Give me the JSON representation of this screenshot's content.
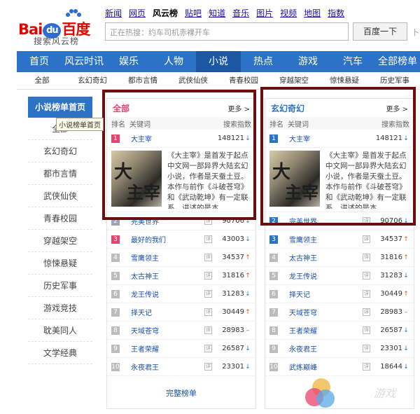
{
  "brand": {
    "left": "Bai",
    "du": "du",
    "right": "百度",
    "sub": "搜索风云榜"
  },
  "topnav": [
    "新闻",
    "网页",
    "风云榜",
    "贴吧",
    "知道",
    "音乐",
    "图片",
    "视频",
    "地图",
    "指数"
  ],
  "search": {
    "placeholder": "正在热搜：约车司机赤裸开车",
    "button": "百度一下"
  },
  "edge_char": "卜",
  "mainnav": [
    "首页",
    "风云时讯",
    "娱乐",
    "人物",
    "小说",
    "热点",
    "游戏",
    "汽车",
    "全部榜单"
  ],
  "subnav": [
    "全部",
    "玄幻奇幻",
    "都市言情",
    "武侠仙侠",
    "青春校园",
    "穿越架空",
    "惊悚悬疑",
    "历史军事"
  ],
  "sidebar": {
    "head": "小说榜单首页",
    "tooltip": "小说榜单首页",
    "items": [
      "全部",
      "玄幻奇幻",
      "都市言情",
      "武侠仙侠",
      "青春校园",
      "穿越架空",
      "惊悚悬疑",
      "历史军事",
      "游戏竞技",
      "耽美同人",
      "文学经典"
    ]
  },
  "panel_left": {
    "title": "全部",
    "more": "更多 >",
    "col_rank": "排名",
    "col_kw": "关键词",
    "col_idx": "搜索指数",
    "top": {
      "rank": "1",
      "kw": "大主宰",
      "num": "148121",
      "dir": "↓"
    },
    "cover": [
      "大",
      "主宰"
    ],
    "desc": "《大主宰》是首发于起点中文网一部异界大陆玄幻小说，作者是天蚕土豆。本作与前作《斗破苍穹》和《武动乾坤》有一定联系，讲述的是本...",
    "rows": [
      {
        "rank": "2",
        "kw": "完美世界",
        "num": "90706",
        "dir": "↓"
      },
      {
        "rank": "3",
        "kw": "最好的我们",
        "num": "43003",
        "dir": "↓"
      },
      {
        "rank": "4",
        "kw": "雪鹰领主",
        "num": "34537",
        "dir": "↑"
      },
      {
        "rank": "5",
        "kw": "太古神王",
        "num": "31816",
        "dir": "↑"
      },
      {
        "rank": "6",
        "kw": "龙王传说",
        "num": "31283",
        "dir": "↓"
      },
      {
        "rank": "7",
        "kw": "择天记",
        "num": "30449",
        "dir": "↑"
      },
      {
        "rank": "8",
        "kw": "天域苍穹",
        "num": "28983",
        "dir": "–"
      },
      {
        "rank": "9",
        "kw": "王者荣耀",
        "num": "26587",
        "dir": "↓"
      },
      {
        "rank": "10",
        "kw": "永夜君王",
        "num": "23301",
        "dir": "↓"
      }
    ],
    "bottom": "完整榜单"
  },
  "panel_right": {
    "title": "玄幻奇幻",
    "more": "更多 >",
    "col_rank": "排名",
    "col_kw": "关键词",
    "col_idx": "搜索指数",
    "top": {
      "rank": "1",
      "kw": "大主宰",
      "num": "148121",
      "dir": "↓"
    },
    "cover": [
      "大",
      "主宰"
    ],
    "desc": "《大主宰》是首发于起点中文网一部异界大陆玄幻小说，作者是天蚕土豆。本作与前作《斗破苍穹》和《武动乾坤》有一定联系，讲述的是本...",
    "rows": [
      {
        "rank": "2",
        "kw": "完美世界",
        "num": "90706",
        "dir": "↓"
      },
      {
        "rank": "3",
        "kw": "雪鹰领主",
        "num": "34537",
        "dir": "↑"
      },
      {
        "rank": "4",
        "kw": "太古神王",
        "num": "31816",
        "dir": "↑"
      },
      {
        "rank": "5",
        "kw": "龙王传说",
        "num": "31283",
        "dir": "↓"
      },
      {
        "rank": "6",
        "kw": "择天记",
        "num": "30449",
        "dir": "↑"
      },
      {
        "rank": "7",
        "kw": "天域苍穹",
        "num": "28983",
        "dir": "–"
      },
      {
        "rank": "8",
        "kw": "王者荣耀",
        "num": "26587",
        "dir": "↓"
      },
      {
        "rank": "9",
        "kw": "永夜君王",
        "num": "23301",
        "dir": "↓"
      },
      {
        "rank": "10",
        "kw": "武炼巅峰",
        "num": "18644",
        "dir": "↓"
      }
    ]
  },
  "tag_char": "详",
  "watermark_text": "游戏",
  "colors": {
    "nav_blue": "#2c73c8",
    "highlight": "#6e0d0d",
    "brand_red": "#e10601"
  }
}
